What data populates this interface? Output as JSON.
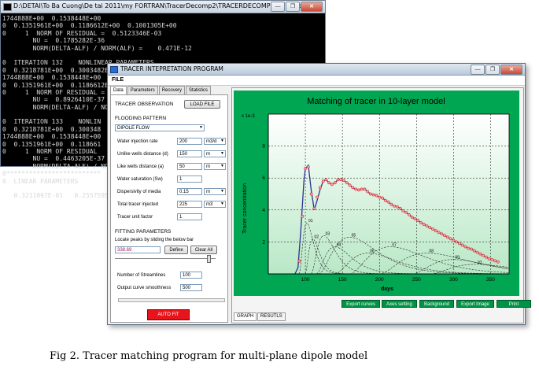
{
  "console": {
    "title": "D:\\DETAI\\To Ba Cuong\\De tai 2011\\my FORTRAN\\TracerDecomp2\\TRACERDECOMPOSITION.exe",
    "lines": [
      "1744888E+00  0.1538448E+00",
      "0  0.1351961E+00  0.1186612E+00  0.1001305E+00",
      "0     1  NORM OF RESIDUAL =  0.5123346E-03",
      "        NU =  0.1785282E-36",
      "        NORM(DELTA-ALF) / NORM(ALF) =    0.471E-12",
      "",
      "0  ITERATION 132    NONLINEAR PARAMETERS",
      "0  0.3218781E+00  0.3003482E+00  0.2468357E+00  0.2215383E+00  0.1966894E+00",
      "1744888E+00  0.1538448E+00",
      "0  0.1351961E+00  0.1186612E+00",
      "0     1  NORM OF RESIDUAL =",
      "        NU =  0.8926410E-37",
      "        NORM(DELTA-ALF) / NORM",
      "",
      "0  ITERATION 133    NONLIN",
      "0  0.3218781E+00  0.300348",
      "1744888E+00  0.1538448E+00",
      "0  0.1351961E+00  0.118661",
      "0     1  NORM OF RESIDUAL",
      "        NU =  0.4463205E-37",
      "        NORM(DELTA-ALF) / NO",
      "0*************************",
      "0  LINEAR PARAMETERS",
      "",
      "   0.3211097E-01   0.2557595"
    ]
  },
  "app": {
    "title": "TRACER INTEPRETATION PROGRAM",
    "menu": "FILE",
    "tabs": [
      "Data",
      "Parameters",
      "Recovery",
      "Statistics"
    ],
    "tracer_observation": "TRACER OBSERVATION",
    "load_file": "LOAD FILE",
    "flooding_pattern": "FLOODING PATTERN",
    "flooding_value": "DIPOLE FLOW",
    "fields": [
      {
        "label": "Water injection rate",
        "value": "200",
        "unit": "m3/d"
      },
      {
        "label": "Unlike wells distance (d)",
        "value": "150",
        "unit": "m"
      },
      {
        "label": "Like wells distance (a)",
        "value": "50",
        "unit": "m"
      },
      {
        "label": "Water saturation (Sw)",
        "value": "1",
        "unit": ""
      },
      {
        "label": "Dispersivity of media",
        "value": "0.15",
        "unit": "m"
      },
      {
        "label": "Total tracer injected",
        "value": "225",
        "unit": "m3"
      },
      {
        "label": "Tracer unit factor",
        "value": "1",
        "unit": ""
      }
    ],
    "fitting_parameters": "FITTING PARAMETERS",
    "locate_peaks": "Locate peaks by sliding the below bar",
    "peaks_value": "338.69",
    "define": "Define",
    "clear_all": "Clear All",
    "streamlines_label": "Number of Streamlines",
    "streamlines_value": "100",
    "smoothness_label": "Output curve smoothness",
    "smoothness_value": "500",
    "autofit": "AUTO FIT",
    "bottom_buttons": [
      "Export curves",
      "Axes setting",
      "Background",
      "Export Image",
      "Print"
    ],
    "bottom_tabs": [
      "GRAPH",
      "RESUTLS"
    ]
  },
  "chart_data": {
    "type": "line",
    "title": "Matching of tracer in 10-layer model",
    "xlabel": "days",
    "ylabel": "Tracer concentration",
    "y_multiplier": "x 1e-3",
    "xlim": [
      50,
      375
    ],
    "ylim": [
      0,
      10
    ],
    "xticks": [
      100,
      150,
      200,
      250,
      300,
      350
    ],
    "yticks": [
      2,
      4,
      6,
      8
    ],
    "grid": true,
    "background": "#00a651",
    "layer_labels": [
      "01",
      "02",
      "03",
      "04",
      "05",
      "06",
      "07",
      "08",
      "09",
      "10"
    ],
    "series": [
      {
        "kind": "observed",
        "color": "#d9262c",
        "x": [
          92,
          96,
          100,
          104,
          108,
          112,
          116,
          120,
          124,
          128,
          132,
          136,
          140,
          144,
          148,
          152,
          156,
          160,
          164,
          168,
          172,
          176,
          180,
          184,
          188,
          192,
          196,
          200,
          204,
          208,
          212,
          216,
          220,
          224,
          228,
          232,
          236,
          240,
          244,
          248,
          252,
          256,
          260,
          264,
          268,
          272,
          276,
          280,
          284,
          288,
          292,
          296,
          300,
          304,
          308,
          312,
          316,
          320,
          324,
          328,
          332,
          336,
          340,
          344,
          348,
          352,
          356,
          360
        ],
        "values": [
          0.8,
          3.6,
          6.6,
          6.7,
          5.0,
          4.1,
          4.8,
          5.4,
          5.8,
          5.9,
          5.7,
          5.6,
          5.7,
          5.9,
          5.9,
          5.85,
          5.7,
          5.55,
          5.4,
          5.3,
          5.25,
          5.3,
          5.3,
          5.15,
          5.0,
          4.95,
          4.9,
          4.8,
          4.75,
          4.6,
          4.5,
          4.35,
          4.25,
          4.2,
          4.1,
          3.95,
          3.85,
          3.7,
          3.55,
          3.45,
          3.35,
          3.2,
          3.1,
          3.0,
          2.9,
          2.8,
          2.7,
          2.6,
          2.5,
          2.4,
          2.3,
          2.2,
          2.1,
          2.0,
          1.9,
          1.8,
          1.7,
          1.6,
          1.55,
          1.45,
          1.35,
          1.25,
          1.15,
          1.05,
          0.95,
          0.9,
          0.82,
          0.75
        ]
      },
      {
        "kind": "fitted",
        "color": "#2e3192",
        "x": [
          86,
          90,
          94,
          98,
          100,
          104,
          108,
          112,
          116,
          120,
          124,
          128,
          132,
          136,
          140,
          144,
          148,
          152,
          156,
          160,
          164,
          168,
          172,
          176,
          180,
          184,
          188,
          192,
          196,
          200,
          204,
          208,
          212,
          216,
          220,
          224,
          228,
          232,
          236,
          240,
          244,
          248,
          252,
          256,
          260,
          264,
          268,
          272,
          276,
          280,
          284,
          288,
          292,
          296,
          300,
          304,
          308,
          312,
          316,
          320,
          324,
          328,
          332,
          336,
          340,
          344,
          348,
          352,
          356,
          360
        ],
        "values": [
          0,
          0.4,
          2.8,
          5.8,
          6.6,
          6.8,
          5.2,
          4.0,
          4.6,
          5.3,
          5.8,
          5.9,
          5.7,
          5.6,
          5.7,
          5.9,
          5.9,
          5.85,
          5.7,
          5.55,
          5.4,
          5.3,
          5.25,
          5.3,
          5.3,
          5.15,
          5.0,
          4.95,
          4.9,
          4.8,
          4.75,
          4.6,
          4.5,
          4.35,
          4.25,
          4.2,
          4.1,
          3.95,
          3.85,
          3.7,
          3.55,
          3.45,
          3.35,
          3.2,
          3.1,
          3.0,
          2.9,
          2.8,
          2.7,
          2.6,
          2.5,
          2.4,
          2.3,
          2.2,
          2.1,
          2.0,
          1.9,
          1.8,
          1.7,
          1.6,
          1.55,
          1.45,
          1.35,
          1.25,
          1.15,
          1.05,
          0.95,
          0.9,
          0.82,
          0.75
        ]
      }
    ],
    "layer_curves": [
      {
        "label": "01",
        "start": 92,
        "peak_x": 102,
        "peak_y": 3.2,
        "width": 8
      },
      {
        "label": "02",
        "start": 100,
        "peak_x": 110,
        "peak_y": 2.2,
        "width": 14
      },
      {
        "label": "03",
        "start": 108,
        "peak_x": 125,
        "peak_y": 2.4,
        "width": 20
      },
      {
        "label": "04",
        "start": 115,
        "peak_x": 140,
        "peak_y": 1.7,
        "width": 24
      },
      {
        "label": "05",
        "start": 118,
        "peak_x": 160,
        "peak_y": 2.3,
        "width": 30
      },
      {
        "label": "06",
        "start": 140,
        "peak_x": 185,
        "peak_y": 1.3,
        "width": 30
      },
      {
        "label": "07",
        "start": 160,
        "peak_x": 215,
        "peak_y": 1.7,
        "width": 34
      },
      {
        "label": "08",
        "start": 200,
        "peak_x": 265,
        "peak_y": 1.3,
        "width": 36
      },
      {
        "label": "09",
        "start": 245,
        "peak_x": 300,
        "peak_y": 0.9,
        "width": 34
      },
      {
        "label": "10",
        "start": 270,
        "peak_x": 330,
        "peak_y": 0.6,
        "width": 30
      }
    ]
  },
  "caption": "Fig 2. Tracer matching program for multi-plane dipole model"
}
